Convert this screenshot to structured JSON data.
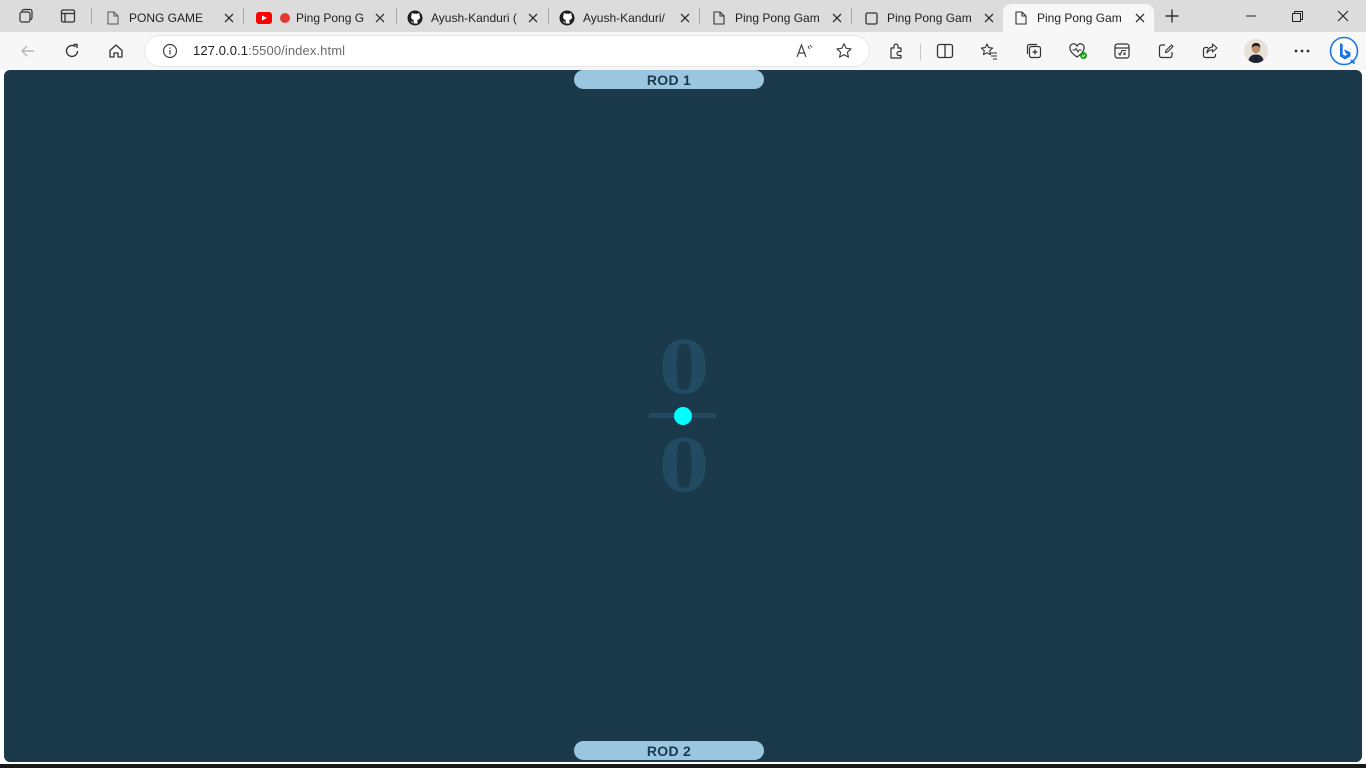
{
  "tabs": [
    {
      "title": "PONG GAME",
      "icon": "page-icon"
    },
    {
      "title": "Ping Pong G",
      "icon": "youtube-icon"
    },
    {
      "title": "Ayush-Kanduri (",
      "icon": "github-icon"
    },
    {
      "title": "Ayush-Kanduri/",
      "icon": "github-icon"
    },
    {
      "title": "Ping Pong Gam",
      "icon": "page-icon"
    },
    {
      "title": "Ping Pong Gam",
      "icon": "square-icon"
    },
    {
      "title": "Ping Pong Gam",
      "icon": "page-icon",
      "active": true
    }
  ],
  "address": {
    "host": "127.0.0.1",
    "path": ":5500/index.html"
  },
  "game": {
    "rod1_label": "ROD 1",
    "rod2_label": "ROD 2",
    "score_top": "0",
    "score_bottom": "0",
    "board_color": "#1a3a4c",
    "rod_color": "#9bc6df",
    "ball_color": "#00ffff"
  }
}
